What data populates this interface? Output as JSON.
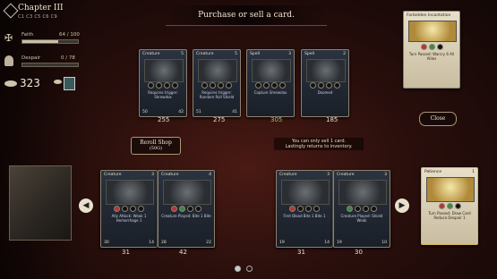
{
  "header": {
    "title": "Purchase or sell a card."
  },
  "chapter": {
    "title": "Chapter III",
    "subtitle": "C1 C3 C5 C6 C9"
  },
  "stats": {
    "faith_label": "Faith",
    "faith_value": "64 / 100",
    "faith_level": 0.64,
    "despair_label": "Despair",
    "despair_value": "0 / 78",
    "despair_level": 0,
    "gold": "323"
  },
  "shop_cards": [
    {
      "title": "Creature",
      "cost": "5",
      "text": "Requires trigger: Shrewdox",
      "atk": "50",
      "hp": "42",
      "price": "255"
    },
    {
      "title": "Creature",
      "cost": "5",
      "text": "Requires trigger: Random Roll Shield",
      "atk": "51",
      "hp": "41",
      "price": "275"
    },
    {
      "title": "Spell",
      "cost": "3",
      "text": "Capture Shrewdox",
      "atk": "",
      "hp": "",
      "price": "305"
    },
    {
      "title": "Spell",
      "cost": "2",
      "text": "Doomed",
      "atk": "",
      "hp": "",
      "price": "185"
    }
  ],
  "featured_card": {
    "title": "Forbidden Incantation",
    "text": "Turn Passed: Warcry 6 All Allies"
  },
  "buttons": {
    "close": "Close",
    "reroll": "Reroll Shop",
    "reroll_cost": "(50G)"
  },
  "hint": {
    "line1": "You can only sell 1 card.",
    "line2": "Lastingly returns to inventory."
  },
  "hand_cards": [
    {
      "title": "Creature",
      "cost": "3",
      "text": "Ally Attack: Weak 1 Hemorrhage 1",
      "atk": "30",
      "hp": "14",
      "price": "31"
    },
    {
      "title": "Creature",
      "cost": "4",
      "text": "Creature Played: Bite 1 Bite",
      "atk": "28",
      "hp": "22",
      "price": "42"
    },
    {
      "title": "Creature",
      "cost": "3",
      "text": "First Blood Bite 1 Bite 1",
      "atk": "19",
      "hp": "14",
      "price": "31"
    },
    {
      "title": "Creature",
      "cost": "3",
      "text": "Creature Played: Shield Weak",
      "atk": "19",
      "hp": "10",
      "price": "30"
    }
  ],
  "patience_card": {
    "title": "Patience",
    "cost": "1",
    "text": "Turn Passed: Draw Card Reduce Despair 1"
  },
  "nav": {
    "prev": "◀",
    "next": "▶"
  }
}
